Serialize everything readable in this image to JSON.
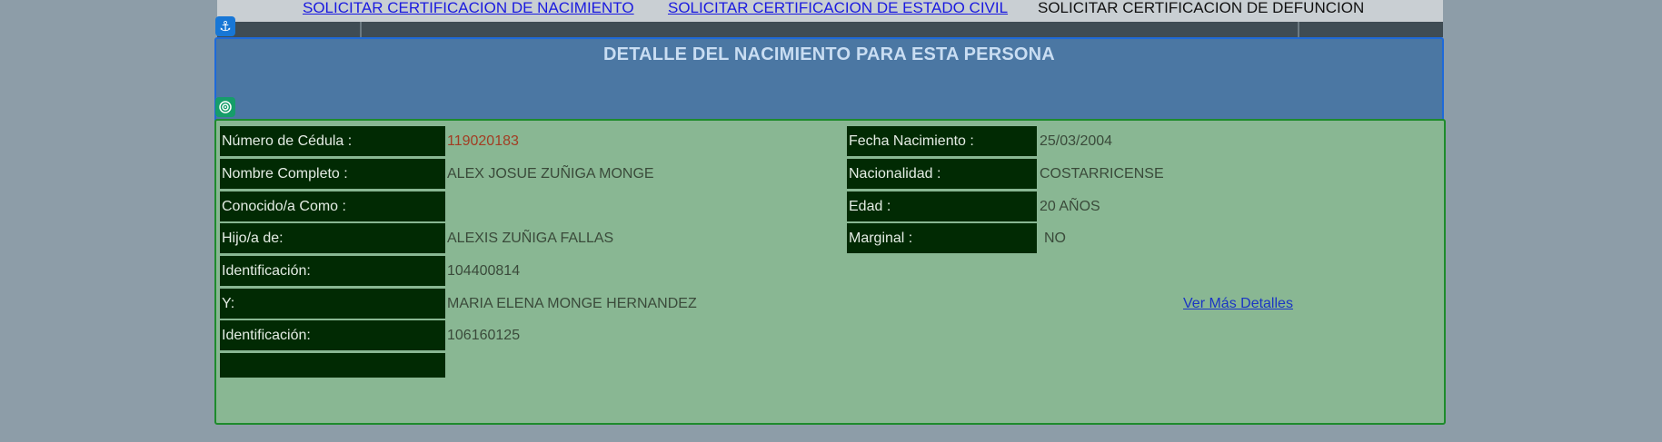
{
  "topnav": {
    "link_nacimiento": "SOLICITAR CERTIFICACION DE NACIMIENTO",
    "link_estado_civil": "SOLICITAR CERTIFICACION DE ESTADO CIVIL",
    "current_defuncion": "SOLICITAR CERTIFICACION DE DEFUNCION"
  },
  "header": {
    "title": "DETALLE DEL NACIMIENTO PARA ESTA PERSONA"
  },
  "icons": {
    "anchor": "anchor-icon",
    "target": "target-icon"
  },
  "left": {
    "cedula_label": "Número de Cédula :",
    "cedula_value": "119020183",
    "nombre_label": "Nombre Completo :",
    "nombre_value": "ALEX JOSUE ZUÑIGA MONGE",
    "conocido_label": "Conocido/a Como :",
    "conocido_value": "",
    "hijo_label": "Hijo/a de:",
    "padre_value": "ALEXIS ZUÑIGA FALLAS",
    "id1_label": "Identificación:",
    "id1_value": "104400814",
    "y_label": "Y:",
    "madre_value": "MARIA ELENA MONGE HERNANDEZ",
    "id2_label": "Identificación:",
    "id2_value": "106160125",
    "empty_label": ""
  },
  "right": {
    "fecha_label": "Fecha Nacimiento :",
    "fecha_value": "25/03/2004",
    "nacionalidad_label": "Nacionalidad :",
    "nacionalidad_value": "COSTARRICENSE",
    "edad_label": "Edad :",
    "edad_value": "20 AÑOS",
    "marginal_label": "Marginal :",
    "marginal_value": "NO"
  },
  "actions": {
    "ver_mas": "Ver Más Detalles"
  },
  "colors": {
    "background": "#8d9da8",
    "header_panel": "#4b77a3",
    "content_panel": "#89b793",
    "label_cell": "#012a03",
    "link": "#1a1adf",
    "cedula_value": "#a23d23"
  }
}
